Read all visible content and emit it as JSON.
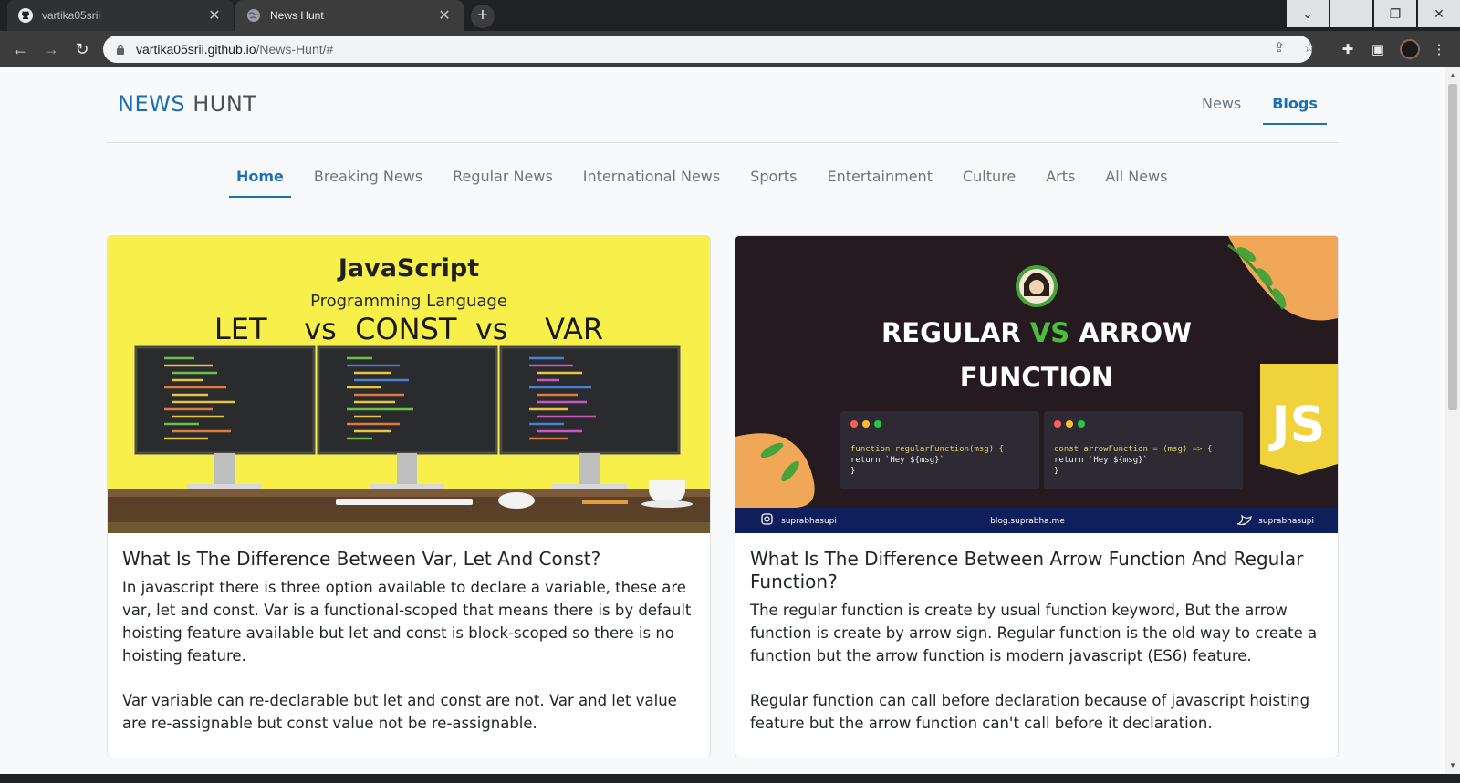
{
  "browser": {
    "tabs": [
      {
        "title": "vartika05srii",
        "icon": "github-icon"
      },
      {
        "title": "News Hunt",
        "icon": "globe-icon"
      }
    ],
    "url_host": "vartika05srii.github.io",
    "url_path": "/News-Hunt/#"
  },
  "site": {
    "brand_part1": "NEWS",
    "brand_part2": "HUNT",
    "accent_color": "#1c6fb5",
    "top_nav": [
      {
        "label": "News",
        "active": false
      },
      {
        "label": "Blogs",
        "active": true
      }
    ],
    "categories": [
      {
        "label": "Home",
        "active": true
      },
      {
        "label": "Breaking News",
        "active": false
      },
      {
        "label": "Regular News",
        "active": false
      },
      {
        "label": "International News",
        "active": false
      },
      {
        "label": "Sports",
        "active": false
      },
      {
        "label": "Entertainment",
        "active": false
      },
      {
        "label": "Culture",
        "active": false
      },
      {
        "label": "Arts",
        "active": false
      },
      {
        "label": "All News",
        "active": false
      }
    ]
  },
  "cards": [
    {
      "image": {
        "heading": "JavaScript",
        "subheading": "Programming Language",
        "line": "LET    vs  CONST  vs    VAR"
      },
      "title": "What Is The Difference Between Var, Let And Const?",
      "para1": "In javascript there is three option available to declare a variable, these are var, let and const. Var is a functional-scoped that means there is by default hoisting feature available but let and const is block-scoped so there is no hoisting feature.",
      "para2": "Var variable can re-declarable but let and const are not. Var and let value are re-assignable but const value not be re-assignable."
    },
    {
      "image": {
        "heading_regular": "REGULAR",
        "heading_vs": "VS",
        "heading_arrow": "ARROW",
        "heading_function": "FUNCTION",
        "code_left_line1": "function regularFunction(msg) {",
        "code_left_line2": "    return `Hey ${msg}`",
        "code_left_line3": "}",
        "code_right_line1": "const arrowFunction = (msg) => {",
        "code_right_line2": "    return `Hey ${msg}`",
        "code_right_line3": "}",
        "footer_left": "suprabhasupi",
        "footer_center": "blog.suprabha.me",
        "footer_right": "suprabhasupi",
        "js_badge": "JS"
      },
      "title": "What Is The Difference Between Arrow Function And Regular Function?",
      "para1": "The regular function is create by usual function keyword, But the arrow function is create by arrow sign. Regular function is the old way to create a function but the arrow function is modern javascript (ES6) feature.",
      "para2": "Regular function can call before declaration because of javascript hoisting feature but the arrow function can't call before it declaration."
    }
  ]
}
